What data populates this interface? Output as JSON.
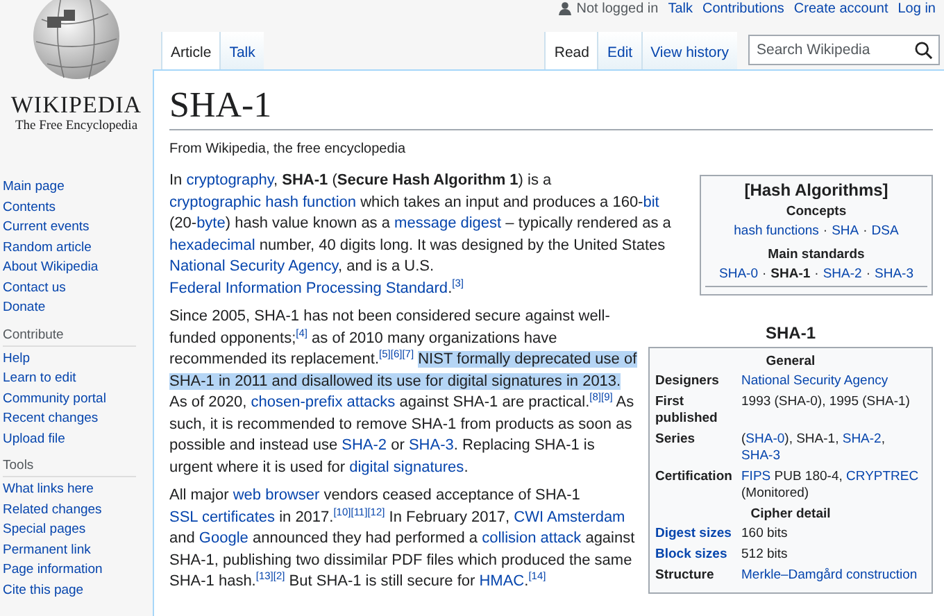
{
  "logo": {
    "wordmark": "WIKIPEDIA",
    "tagline": "The Free Encyclopedia"
  },
  "personal": {
    "status": "Not logged in",
    "links": [
      "Talk",
      "Contributions",
      "Create account",
      "Log in"
    ]
  },
  "tabs_left": [
    {
      "label": "Article",
      "selected": true
    },
    {
      "label": "Talk",
      "selected": false
    }
  ],
  "tabs_right": [
    {
      "label": "Read",
      "selected": true
    },
    {
      "label": "Edit",
      "selected": false
    },
    {
      "label": "View history",
      "selected": false
    }
  ],
  "search": {
    "placeholder": "Search Wikipedia"
  },
  "sidebar": [
    {
      "items": [
        "Main page",
        "Contents",
        "Current events",
        "Random article",
        "About Wikipedia",
        "Contact us",
        "Donate"
      ]
    },
    {
      "heading": "Contribute",
      "items": [
        "Help",
        "Learn to edit",
        "Community portal",
        "Recent changes",
        "Upload file"
      ]
    },
    {
      "heading": "Tools",
      "items": [
        "What links here",
        "Related changes",
        "Special pages",
        "Permanent link",
        "Page information",
        "Cite this page"
      ]
    }
  ],
  "article": {
    "title": "SHA-1",
    "subtitle": "From Wikipedia, the free encyclopedia",
    "paragraphs": [
      [
        {
          "kind": "text",
          "text": "In "
        },
        {
          "kind": "link",
          "text": "cryptography"
        },
        {
          "kind": "text",
          "text": ", "
        },
        {
          "kind": "bold",
          "text": "SHA-1"
        },
        {
          "kind": "text",
          "text": " ("
        },
        {
          "kind": "bold",
          "text": "Secure Hash Algorithm 1"
        },
        {
          "kind": "text",
          "text": ") is a "
        },
        {
          "kind": "link",
          "text": "cryptographic hash function"
        },
        {
          "kind": "text",
          "text": " which takes an input and produces a 160-"
        },
        {
          "kind": "link",
          "text": "bit"
        },
        {
          "kind": "text",
          "text": " (20-"
        },
        {
          "kind": "link",
          "text": "byte"
        },
        {
          "kind": "text",
          "text": ") hash value known as a "
        },
        {
          "kind": "link",
          "text": "message digest"
        },
        {
          "kind": "text",
          "text": " – typically rendered as a "
        },
        {
          "kind": "link",
          "text": "hexadecimal"
        },
        {
          "kind": "text",
          "text": " number, 40 digits long. It was designed by the United States "
        },
        {
          "kind": "link",
          "text": "National Security Agency"
        },
        {
          "kind": "text",
          "text": ", and is a U.S. "
        },
        {
          "kind": "link",
          "text": "Federal Information Processing Standard"
        },
        {
          "kind": "text",
          "text": "."
        },
        {
          "kind": "ref",
          "text": "[3]"
        }
      ],
      [
        {
          "kind": "text",
          "text": "Since 2005, SHA-1 has not been considered secure against well-funded opponents;"
        },
        {
          "kind": "ref",
          "text": "[4]"
        },
        {
          "kind": "text",
          "text": " as of 2010 many organizations have recommended its replacement."
        },
        {
          "kind": "ref",
          "text": "[5]"
        },
        {
          "kind": "ref",
          "text": "[6]"
        },
        {
          "kind": "ref",
          "text": "[7]"
        },
        {
          "kind": "space"
        },
        {
          "kind": "highlight",
          "text": "NIST formally deprecated use of SHA-1 in 2011 and disallowed its use for digital signatures in 2013."
        },
        {
          "kind": "text",
          "text": " As of 2020, "
        },
        {
          "kind": "link",
          "text": "chosen-prefix attacks"
        },
        {
          "kind": "text",
          "text": " against SHA-1 are practical."
        },
        {
          "kind": "ref",
          "text": "[8]"
        },
        {
          "kind": "ref",
          "text": "[9]"
        },
        {
          "kind": "text",
          "text": " As such, it is recommended to remove SHA-1 from products as soon as possible and instead use "
        },
        {
          "kind": "link",
          "text": "SHA-2"
        },
        {
          "kind": "text",
          "text": " or "
        },
        {
          "kind": "link",
          "text": "SHA-3"
        },
        {
          "kind": "text",
          "text": ". Replacing SHA-1 is urgent where it is used for "
        },
        {
          "kind": "link",
          "text": "digital signatures"
        },
        {
          "kind": "text",
          "text": "."
        }
      ],
      [
        {
          "kind": "text",
          "text": "All major "
        },
        {
          "kind": "link",
          "text": "web browser"
        },
        {
          "kind": "text",
          "text": " vendors ceased acceptance of SHA-1 "
        },
        {
          "kind": "link",
          "text": "SSL certificates"
        },
        {
          "kind": "text",
          "text": " in 2017."
        },
        {
          "kind": "ref",
          "text": "[10]"
        },
        {
          "kind": "ref",
          "text": "[11]"
        },
        {
          "kind": "ref",
          "text": "[12]"
        },
        {
          "kind": "text",
          "text": " In February 2017, "
        },
        {
          "kind": "link",
          "text": "CWI Amsterdam"
        },
        {
          "kind": "text",
          "text": " and "
        },
        {
          "kind": "link",
          "text": "Google"
        },
        {
          "kind": "text",
          "text": " announced they had performed a "
        },
        {
          "kind": "link",
          "text": "collision attack"
        },
        {
          "kind": "text",
          "text": " against SHA-1, publishing two dissimilar PDF files which produced the same SHA-1 hash."
        },
        {
          "kind": "ref",
          "text": "[13]"
        },
        {
          "kind": "ref",
          "text": "[2]"
        },
        {
          "kind": "text",
          "text": " But SHA-1 is still secure for "
        },
        {
          "kind": "link",
          "text": "HMAC"
        },
        {
          "kind": "text",
          "text": "."
        },
        {
          "kind": "ref",
          "text": "[14]"
        }
      ]
    ]
  },
  "navbox": {
    "title": "[Hash Algorithms]",
    "separator": "·",
    "groups": [
      {
        "heading": "Concepts",
        "items": [
          {
            "text": "hash functions",
            "current": false
          },
          {
            "text": "SHA",
            "current": false
          },
          {
            "text": "DSA",
            "current": false
          }
        ]
      },
      {
        "heading": "Main standards",
        "items": [
          {
            "text": "SHA-0",
            "current": false
          },
          {
            "text": "SHA-1",
            "current": true
          },
          {
            "text": "SHA-2",
            "current": false
          },
          {
            "text": "SHA-3",
            "current": false
          }
        ]
      }
    ]
  },
  "infobox": {
    "caption": "SHA-1",
    "rows": [
      {
        "kind": "header",
        "text": "General"
      },
      {
        "kind": "row",
        "label": "Designers",
        "label_link": false,
        "value": [
          {
            "kind": "link",
            "text": "National Security Agency"
          }
        ]
      },
      {
        "kind": "row",
        "label": "First published",
        "label_link": false,
        "value": [
          {
            "kind": "text",
            "text": "1993 (SHA-0), 1995 (SHA-1)"
          }
        ]
      },
      {
        "kind": "row",
        "label": "Series",
        "label_link": false,
        "value": [
          {
            "kind": "text",
            "text": "("
          },
          {
            "kind": "link",
            "text": "SHA-0"
          },
          {
            "kind": "text",
            "text": "), SHA-1, "
          },
          {
            "kind": "link",
            "text": "SHA-2"
          },
          {
            "kind": "text",
            "text": ", "
          },
          {
            "kind": "link",
            "text": "SHA-3"
          }
        ]
      },
      {
        "kind": "row",
        "label": "Certification",
        "label_link": false,
        "value": [
          {
            "kind": "link",
            "text": "FIPS"
          },
          {
            "kind": "text",
            "text": " PUB 180-4, "
          },
          {
            "kind": "link",
            "text": "CRYPTREC"
          },
          {
            "kind": "text",
            "text": " (Monitored)"
          }
        ]
      },
      {
        "kind": "header",
        "text": "Cipher detail"
      },
      {
        "kind": "row",
        "label": "Digest sizes",
        "label_link": true,
        "value": [
          {
            "kind": "text",
            "text": "160 bits"
          }
        ]
      },
      {
        "kind": "row",
        "label": "Block sizes",
        "label_link": true,
        "value": [
          {
            "kind": "text",
            "text": "512 bits"
          }
        ]
      },
      {
        "kind": "row",
        "label": "Structure",
        "label_link": false,
        "value": [
          {
            "kind": "link",
            "text": "Merkle–Damgård construction"
          }
        ]
      }
    ]
  }
}
